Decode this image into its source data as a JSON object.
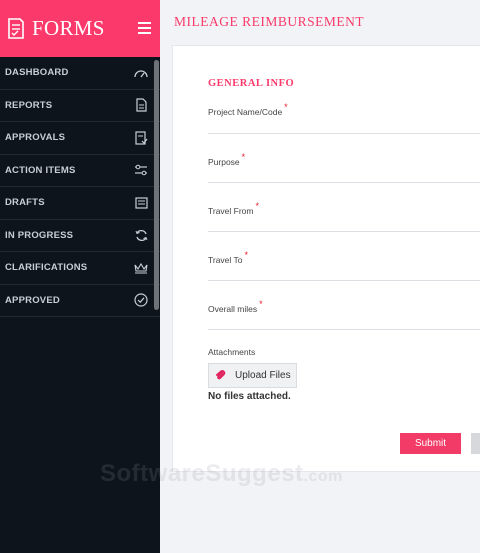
{
  "app": {
    "brand_title": "FORMS"
  },
  "sidebar": {
    "items": [
      {
        "label": "DASHBOARD",
        "icon": "speedometer-icon"
      },
      {
        "label": "REPORTS",
        "icon": "document-icon"
      },
      {
        "label": "APPROVALS",
        "icon": "checklist-icon"
      },
      {
        "label": "ACTION ITEMS",
        "icon": "sliders-icon"
      },
      {
        "label": "DRAFTS",
        "icon": "draft-icon"
      },
      {
        "label": "IN PROGRESS",
        "icon": "refresh-icon"
      },
      {
        "label": "CLARIFICATIONS",
        "icon": "crown-icon"
      },
      {
        "label": "APPROVED",
        "icon": "check-circle-icon"
      }
    ]
  },
  "page": {
    "title": "MILEAGE REIMBURSEMENT"
  },
  "form": {
    "section_title": "GENERAL INFO",
    "required_mark": "*",
    "fields": [
      {
        "label": "Project Name/Code",
        "value": ""
      },
      {
        "label": "Purpose",
        "value": ""
      },
      {
        "label": "Travel From",
        "value": ""
      },
      {
        "label": "Travel To",
        "value": ""
      },
      {
        "label": "Overall miles",
        "value": ""
      }
    ],
    "attachments_label": "Attachments",
    "upload_label": "Upload Files",
    "no_files_text": "No files attached.",
    "submit_label": "Submit"
  },
  "watermark": {
    "text": "SoftwareSuggest",
    "suffix": ".com"
  },
  "colors": {
    "accent": "#fb3a6b",
    "sidebar_bg": "#0d141c",
    "submit": "#f23b66"
  }
}
